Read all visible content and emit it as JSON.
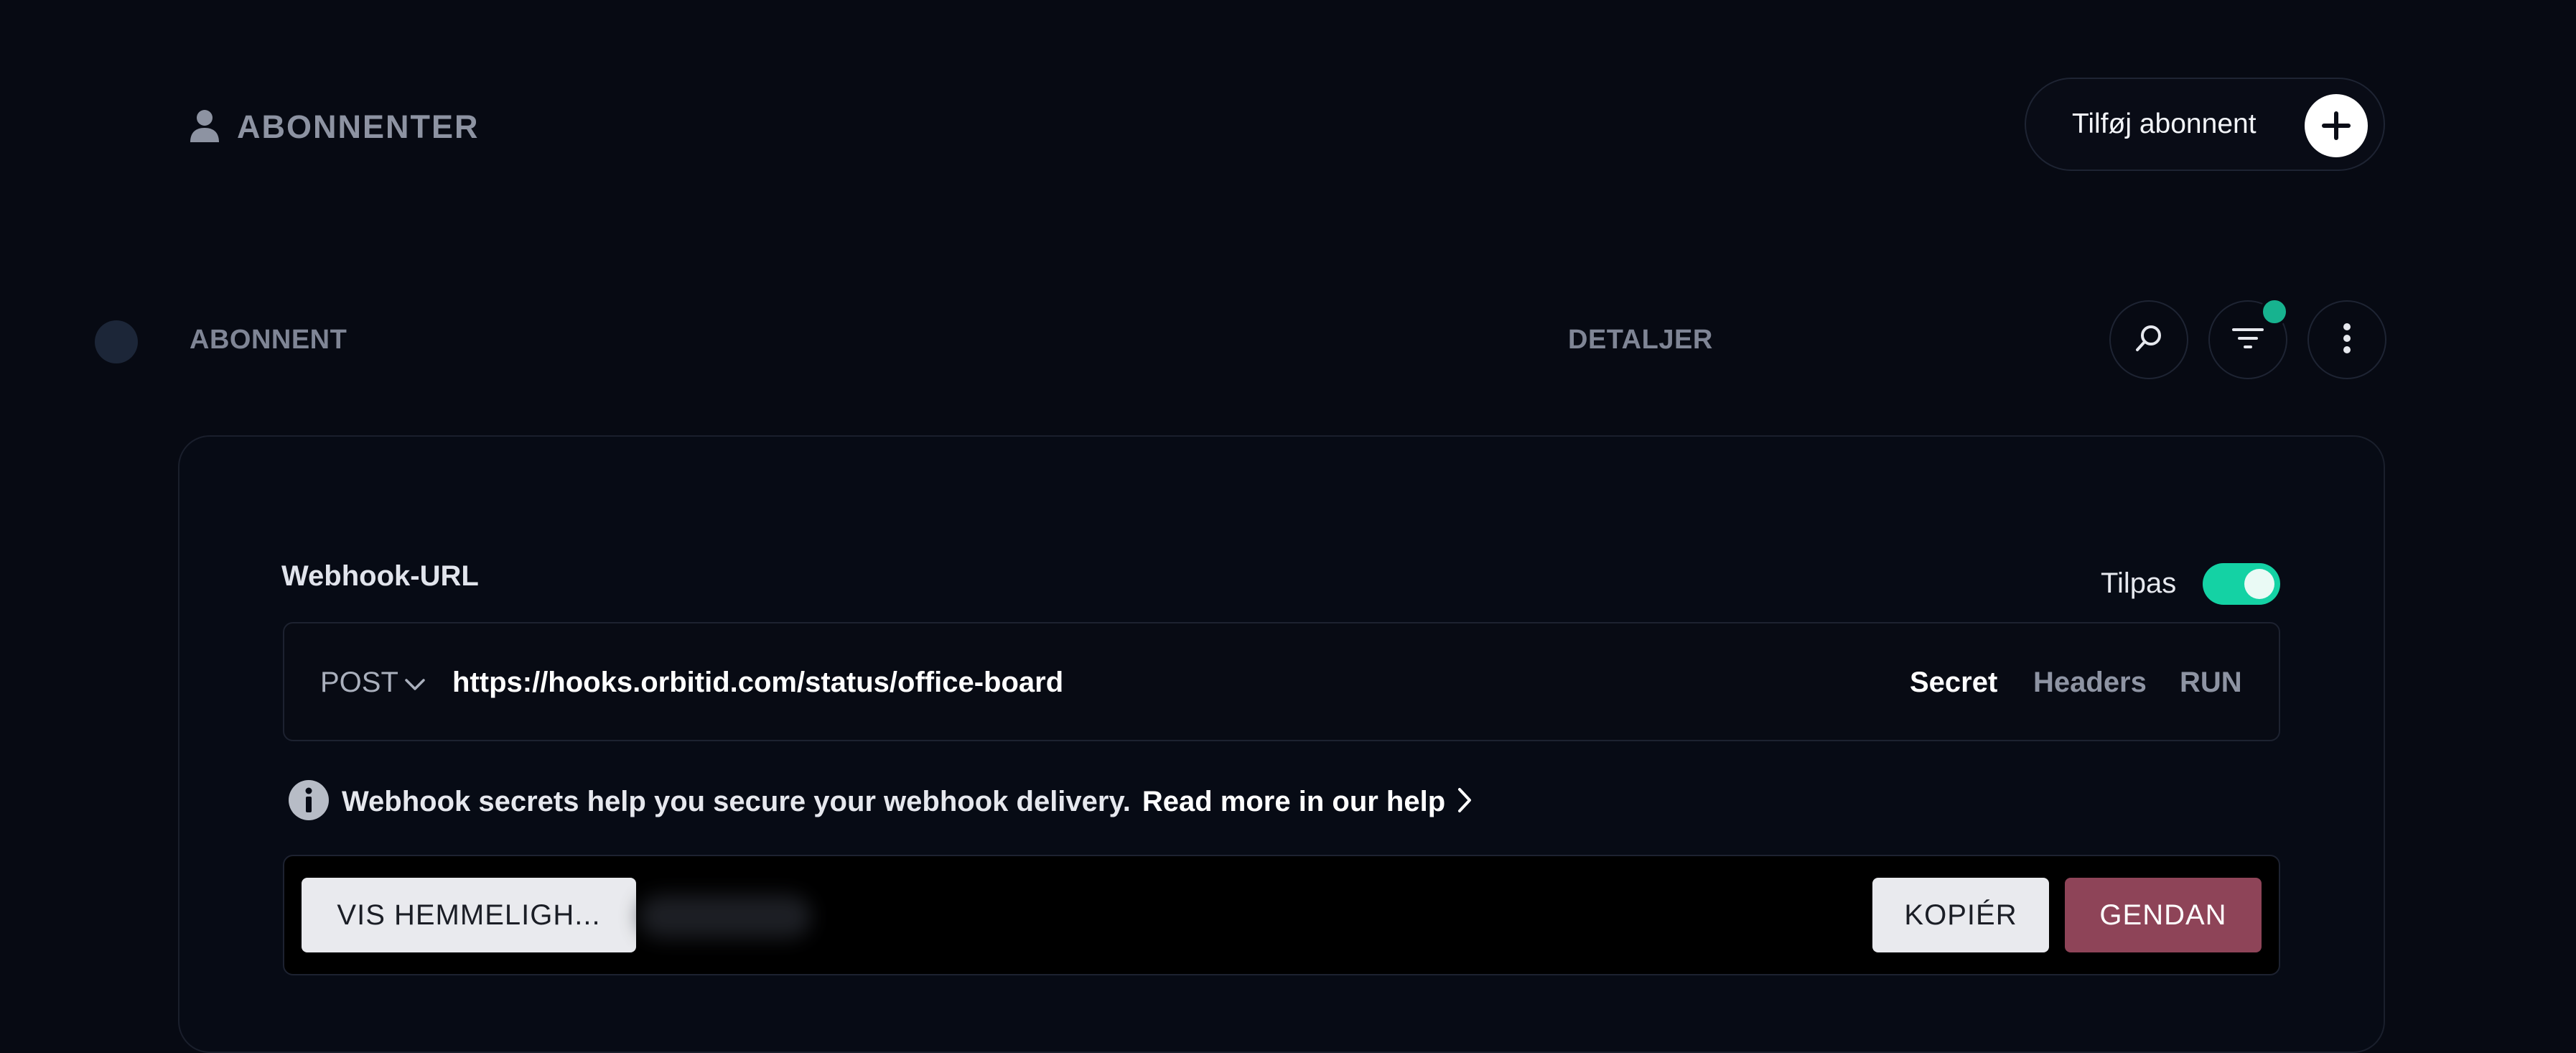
{
  "header": {
    "title": "ABONNENTER",
    "title_icon": "person-icon",
    "add_button_label": "Tilføj abonnent",
    "add_button_icon": "plus-icon"
  },
  "table_header": {
    "col_subscriber": "ABONNENT",
    "col_details": "DETALJER",
    "actions": [
      "search-icon",
      "filter-icon",
      "more-vertical-icon"
    ],
    "filter_active_color": "#17b38f"
  },
  "webhook": {
    "section_title": "Webhook-URL",
    "toggle_label": "Tilpas",
    "toggle_on": true,
    "toggle_color": "#14d2a4",
    "method": "POST",
    "url": "https://hooks.orbitid.com/status/office-board",
    "tabs": [
      {
        "label": "Secret",
        "active": true
      },
      {
        "label": "Headers",
        "active": false
      },
      {
        "label": "RUN",
        "active": false
      }
    ],
    "info_text": "Webhook secrets help you secure your webhook delivery.",
    "info_link": "Read more in our help",
    "show_secret_label": "VIS HEMMELIGH...",
    "copy_label": "KOPIÉR",
    "reset_label": "GENDAN",
    "reset_color": "#8e4458"
  }
}
